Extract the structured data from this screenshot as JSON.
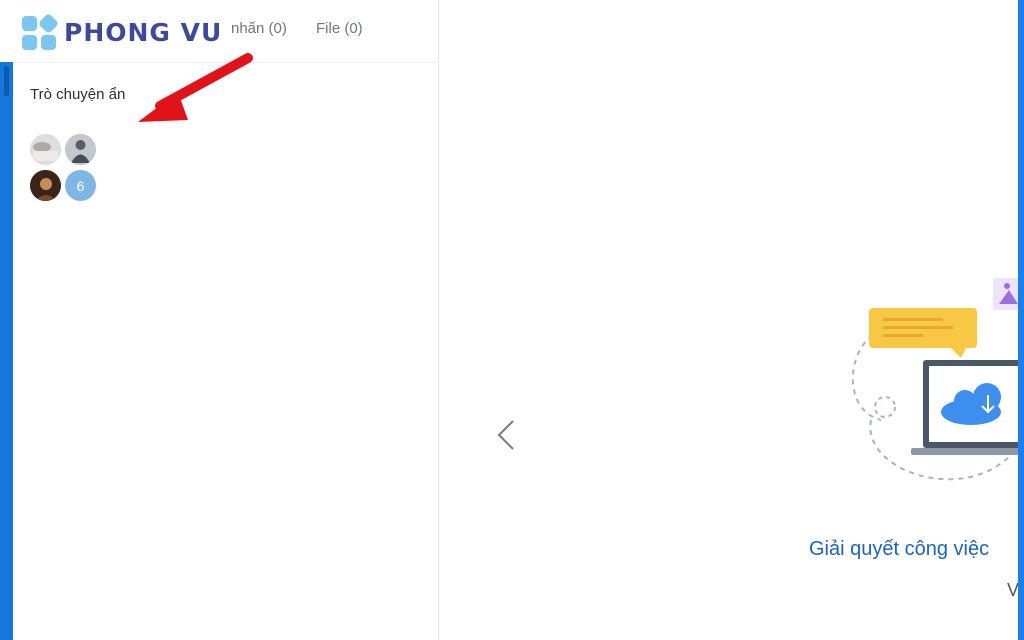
{
  "brand": {
    "name": "PHONG VU"
  },
  "sidebar": {
    "tabs": [
      {
        "label": "nhấn (0)"
      },
      {
        "label": "File (0)"
      }
    ],
    "section_title": "Trò chuyện ẩn",
    "group": {
      "extra_count": "6"
    }
  },
  "main": {
    "slide_title": "Giải quyết công việc",
    "slide_subtitle": "V"
  },
  "colors": {
    "accent": "#1577d9",
    "title_blue": "#1d64b8",
    "arrow_red": "#e0121a",
    "logo_blue": "#3d4a9c"
  },
  "icons": [
    "chevron-left-icon",
    "red-arrow-annotation",
    "cloud-download-icon",
    "chat-bubble-icon",
    "image-icon"
  ]
}
